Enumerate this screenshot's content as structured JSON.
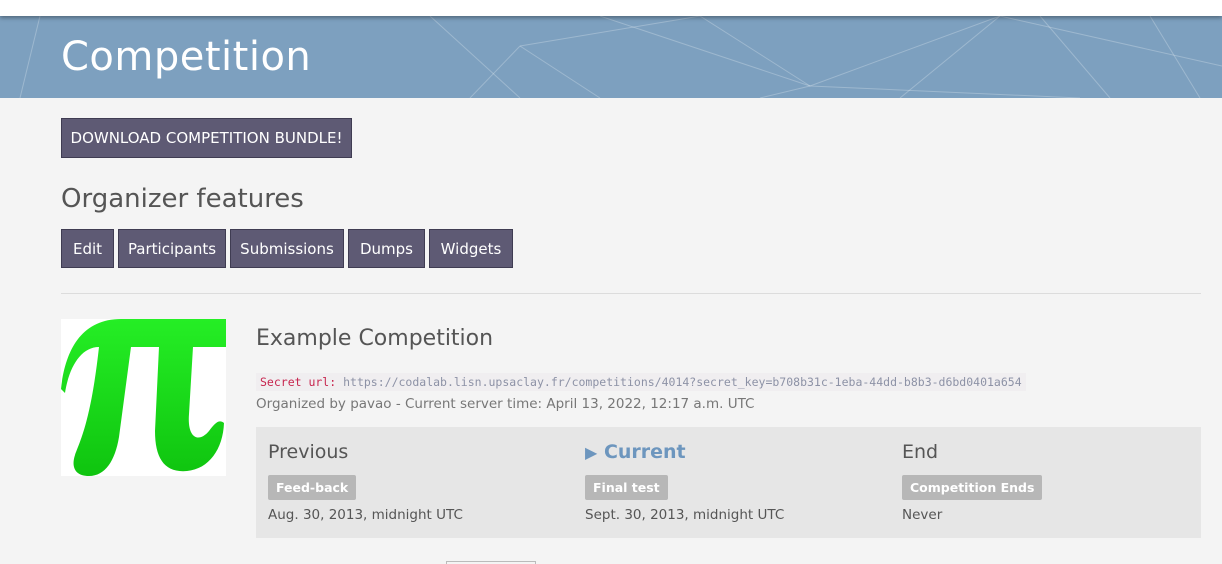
{
  "banner": {
    "title": "Competition"
  },
  "download_button": {
    "label": "DOWNLOAD COMPETITION BUNDLE!"
  },
  "organizer": {
    "title": "Organizer features",
    "buttons": [
      {
        "label": "Edit"
      },
      {
        "label": "Participants"
      },
      {
        "label": "Submissions"
      },
      {
        "label": "Dumps"
      },
      {
        "label": "Widgets"
      }
    ]
  },
  "competition": {
    "logo_icon": "pi-icon",
    "title": "Example Competition",
    "secret_label": "Secret url:",
    "secret_url": "https://codalab.lisn.upsaclay.fr/competitions/4014?secret_key=b708b31c-1eba-44dd-b8b3-d6bd0401a654",
    "organized": "Organized by pavao - Current server time: April 13, 2022, 12:17 a.m. UTC"
  },
  "phases": [
    {
      "name": "Previous",
      "badge": "Feed-back",
      "date": "Aug. 30, 2013, midnight UTC"
    },
    {
      "name": "Current",
      "badge": "Final test",
      "date": "Sept. 30, 2013, midnight UTC"
    },
    {
      "name": "End",
      "badge": "Competition Ends",
      "date": "Never"
    }
  ],
  "colors": {
    "banner": "#7da0bf",
    "button": "#5e5a74",
    "current_phase": "#6d96be",
    "logo_green": "#1ed81e",
    "secret_label": "#c7254e"
  }
}
